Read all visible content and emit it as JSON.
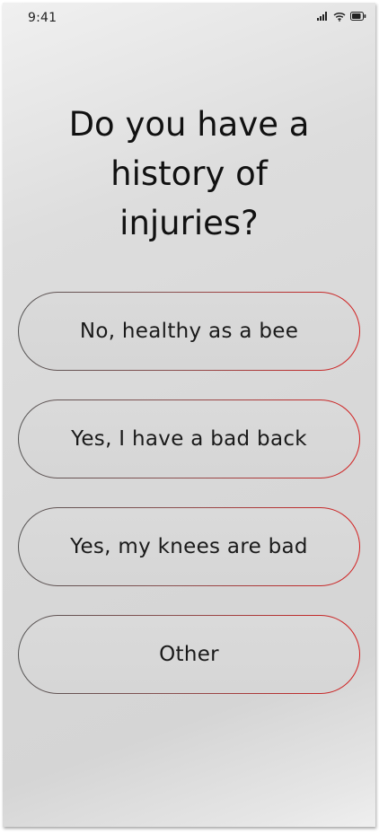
{
  "status_bar": {
    "time": "9:41",
    "icons": [
      "cellular-signal-icon",
      "wifi-icon",
      "battery-icon"
    ]
  },
  "question": {
    "title": "Do you have a history of injuries?"
  },
  "options": [
    {
      "label": "No, healthy as a bee"
    },
    {
      "label": "Yes, I have a bad back"
    },
    {
      "label": "Yes, my knees are bad"
    },
    {
      "label": "Other"
    }
  ],
  "colors": {
    "option_border_start": "#555555",
    "option_border_end": "#d42020",
    "text": "#111111"
  }
}
